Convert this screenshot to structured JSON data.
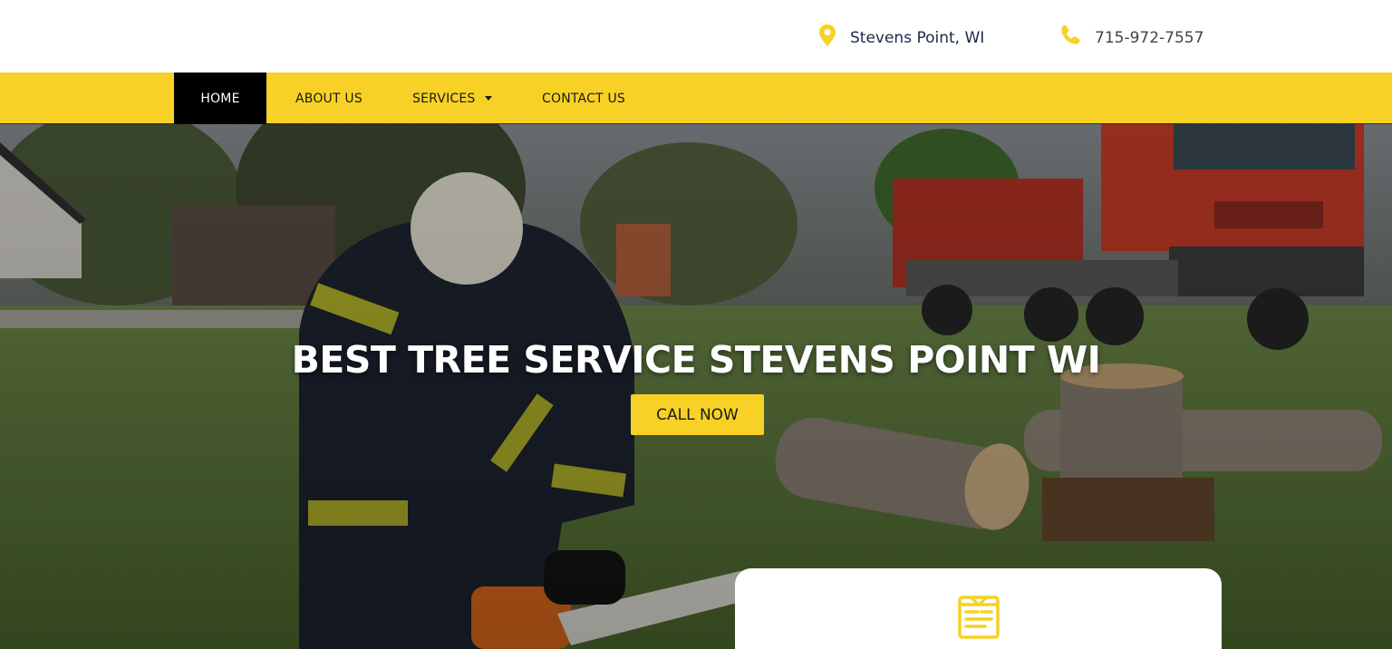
{
  "header": {
    "location": {
      "icon": "map-pin-icon",
      "text": "Stevens Point, WI"
    },
    "phone": {
      "icon": "phone-icon",
      "text": "715-972-7557"
    }
  },
  "nav": {
    "items": [
      {
        "label": "HOME",
        "active": true
      },
      {
        "label": "ABOUT US",
        "active": false
      },
      {
        "label": "SERVICES",
        "active": false,
        "has_dropdown": true
      },
      {
        "label": "CONTACT US",
        "active": false
      }
    ]
  },
  "hero": {
    "title": "BEST TREE SERVICE STEVENS POINT WI",
    "cta_label": "CALL NOW",
    "image_description_icon": "hero-photo"
  },
  "card": {
    "icon": "form-document-icon"
  },
  "colors": {
    "brand_yellow": "#f7d125",
    "nav_active": "#000000",
    "text_dark": "#1b2a4a"
  }
}
